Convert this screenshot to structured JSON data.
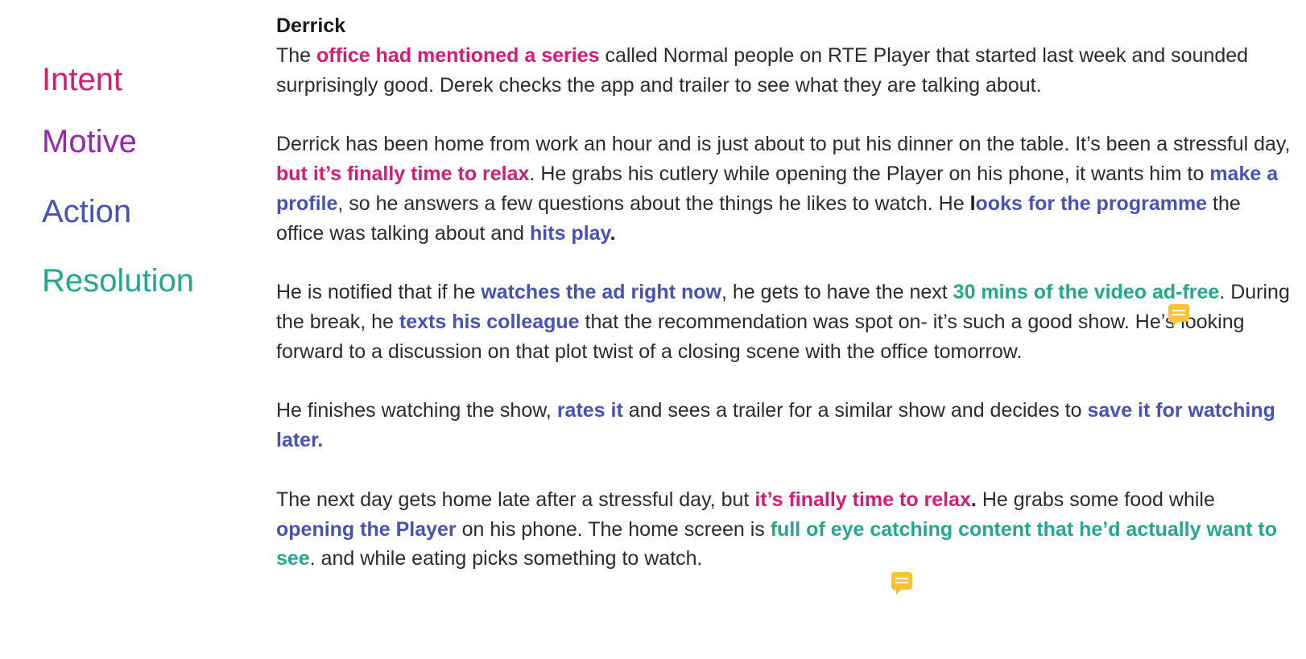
{
  "legend": {
    "intent": "Intent",
    "motive": "Motive",
    "action": "Action",
    "resolution": "Resolution"
  },
  "colors": {
    "intent": "#d81b72",
    "motive": "#9a24b3",
    "action": "#4553b8",
    "resolution": "#22a88a",
    "comment": "#f7c531"
  },
  "story": {
    "title": "Derrick",
    "p1": {
      "t1": "The ",
      "h1": "office had mentioned a series",
      "t2": " called Normal people on RTE Player that started last week and sounded surprisingly good. Derek checks the app and trailer to see what they are talking about."
    },
    "p2": {
      "t1": "Derrick has been home from work an hour and is just about to put his dinner on the table. It’s been a stressful day, ",
      "h1": "but it’s finally time to relax",
      "t2": ". He grabs his cutlery while opening the Player on his phone, it wants him to ",
      "h2": "make a profile",
      "t3": ", so he answers a few questions about the things he likes to watch. He ",
      "b1": "l",
      "h3": "ooks for the programme",
      "t4": " the office was talking about and ",
      "h4": "hits play",
      "b2": "."
    },
    "p3": {
      "t1": "He is notified that if he ",
      "h1": "watches the ad right now",
      "t2": ", he gets to have the next ",
      "h2": "30 mins of the video ad-free",
      "t3": ". During the break, he ",
      "h3": "texts his colleague",
      "t4": " that the recommendation was spot on- it’s such a good show. He’s looking forward to a discussion on that plot twist of a closing scene with the office tomorrow."
    },
    "p4": {
      "t1": "He finishes watching the show, ",
      "h1": "rates it",
      "t2": " and sees a trailer for a similar show and decides to ",
      "h2": "save it for watching later."
    },
    "p5": {
      "t1": "The next day gets home late after a stressful day, but ",
      "h1": "it’s finally time to relax",
      "b1": ".",
      "t2": " He grabs some food while ",
      "h2": "opening the Player",
      "t3": " on his phone. The home screen is ",
      "h3": "full of eye catching content that he’d actually want to see",
      "t4": ". and while eating picks something to watch."
    }
  }
}
